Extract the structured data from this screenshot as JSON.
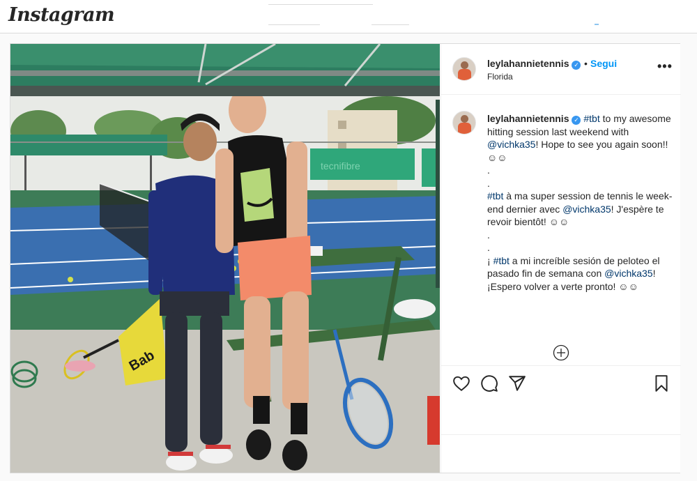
{
  "app": {
    "logo_text": "Instagram"
  },
  "post": {
    "author": {
      "username": "leylahannietennis",
      "verified": true,
      "follow_label": "Segui",
      "location": "Florida"
    },
    "more_icon": "more-options-icon",
    "caption": {
      "lines": [
        {
          "parts": [
            {
              "t": "#tbt",
              "k": "tag"
            },
            {
              "t": " to my awesome hitting session last weekend with ",
              "k": "text"
            },
            {
              "t": "@vichka35",
              "k": "mention"
            },
            {
              "t": "! Hope to see you again soon!! ☺☺",
              "k": "text"
            }
          ]
        },
        {
          "parts": [
            {
              "t": ".",
              "k": "text"
            }
          ]
        },
        {
          "parts": [
            {
              "t": ".",
              "k": "text"
            }
          ]
        },
        {
          "parts": [
            {
              "t": "#tbt",
              "k": "tag"
            },
            {
              "t": " à ma super session de tennis le week-end dernier avec ",
              "k": "text"
            },
            {
              "t": "@vichka35",
              "k": "mention"
            },
            {
              "t": "! J'espère te revoir bientôt! ☺☺",
              "k": "text"
            }
          ]
        },
        {
          "parts": [
            {
              "t": ".",
              "k": "text"
            }
          ]
        },
        {
          "parts": [
            {
              "t": ".",
              "k": "text"
            }
          ]
        },
        {
          "parts": [
            {
              "t": "¡ ",
              "k": "text"
            },
            {
              "t": "#tbt",
              "k": "tag"
            },
            {
              "t": " a mi increíble sesión de peloteo el pasado fin de semana con ",
              "k": "text"
            },
            {
              "t": "@vichka35",
              "k": "mention"
            },
            {
              "t": "! ¡Espero volver a verte pronto! ☺☺",
              "k": "text"
            }
          ]
        }
      ]
    },
    "photo_banner_text": "tecnifibre",
    "actions": [
      "like-heart-icon",
      "comment-bubble-icon",
      "share-send-icon",
      "save-bookmark-icon"
    ],
    "add_comment_icon": "add-circle-icon"
  },
  "colors": {
    "link": "#0095f6",
    "verified": "#3897f0",
    "hashtag": "#00376b"
  }
}
